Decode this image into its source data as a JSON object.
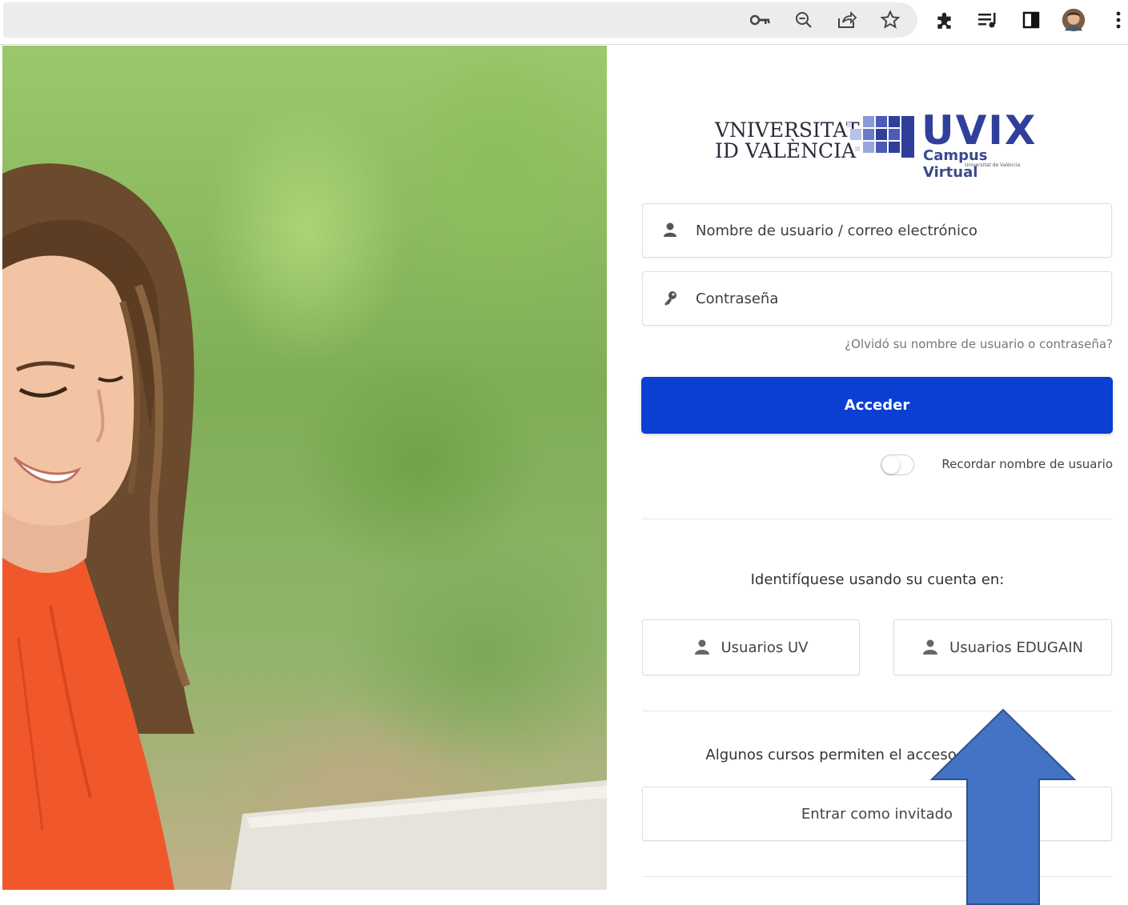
{
  "browser": {
    "icons": [
      "key-icon",
      "zoom-out-icon",
      "share-icon",
      "bookmark-star-icon",
      "extensions-icon",
      "reading-list-icon",
      "side-panel-icon",
      "profile-avatar",
      "more-menu-icon"
    ]
  },
  "branding": {
    "university_line1": "VNIVERSITAT",
    "university_line2": "ID VALÈNCIA",
    "product_name": "UVIX",
    "product_subtitle": "Campus Virtual",
    "product_tagline": "Universitat de València",
    "brand_color": "#2f3f9a"
  },
  "login": {
    "username_placeholder": "Nombre de usuario / correo electrónico",
    "password_placeholder": "Contraseña",
    "forgot_link": "¿Olvidó su nombre de usuario o contraseña?",
    "submit_label": "Acceder",
    "submit_color": "#0a3fd2",
    "remember_label": "Recordar nombre de usuario",
    "remember_checked": false
  },
  "sso": {
    "heading": "Identifíquese usando su cuenta en:",
    "options": [
      {
        "label": "Usuarios UV"
      },
      {
        "label": "Usuarios EDUGAIN"
      }
    ]
  },
  "guest": {
    "note": "Algunos cursos permiten el acceso de invitados",
    "button_label": "Entrar como invitado"
  },
  "annotation": {
    "arrow_color": "#4472c4"
  }
}
